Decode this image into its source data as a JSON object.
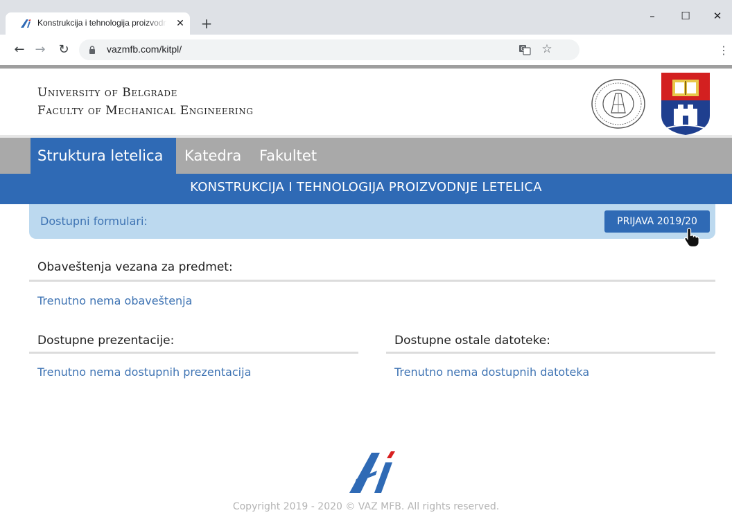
{
  "browser": {
    "tab_title": "Konstrukcija i tehnologija proizvodnje letelica",
    "url": "vazmfb.com/kitpl/",
    "icons": {
      "tab_favicon": "vaz-logo-icon",
      "tab_close": "close-icon",
      "new_tab": "plus-icon",
      "back": "arrow-left-icon",
      "forward": "arrow-right-icon",
      "reload": "reload-icon",
      "lock": "lock-icon",
      "translate": "translate-icon",
      "bookmark": "star-icon",
      "menu": "kebab-menu-icon",
      "minimize": "minimize-icon",
      "maximize": "maximize-icon",
      "close_window": "close-icon"
    }
  },
  "header": {
    "university": "University of Belgrade",
    "faculty": "Faculty of Mechanical Engineering"
  },
  "nav": {
    "tabs": [
      {
        "label": "Struktura letelica",
        "active": true
      },
      {
        "label": "Katedra",
        "active": false
      },
      {
        "label": "Fakultet",
        "active": false
      }
    ]
  },
  "page": {
    "title": "KONSTRUKCIJA I TEHNOLOGIJA PROIZVODNJE LETELICA",
    "forms": {
      "label": "Dostupni formulari:",
      "button": "PRIJAVA 2019/20"
    },
    "notices": {
      "heading": "Obaveštenja vezana za predmet:",
      "message": "Trenutno nema obaveštenja"
    },
    "presentations": {
      "heading": "Dostupne prezentacije:",
      "message": "Trenutno nema dostupnih prezentacija"
    },
    "files": {
      "heading": "Dostupne ostale datoteke:",
      "message": "Trenutno nema dostupnih datoteka"
    }
  },
  "footer": {
    "copyright": "Copyright 2019 - 2020 © VAZ MFB. All rights reserved."
  },
  "colors": {
    "brand_blue": "#2f6ab5",
    "nav_gray": "#a9a9a9",
    "panel_blue": "#bcd9ef",
    "link_blue": "#3e73b3"
  }
}
